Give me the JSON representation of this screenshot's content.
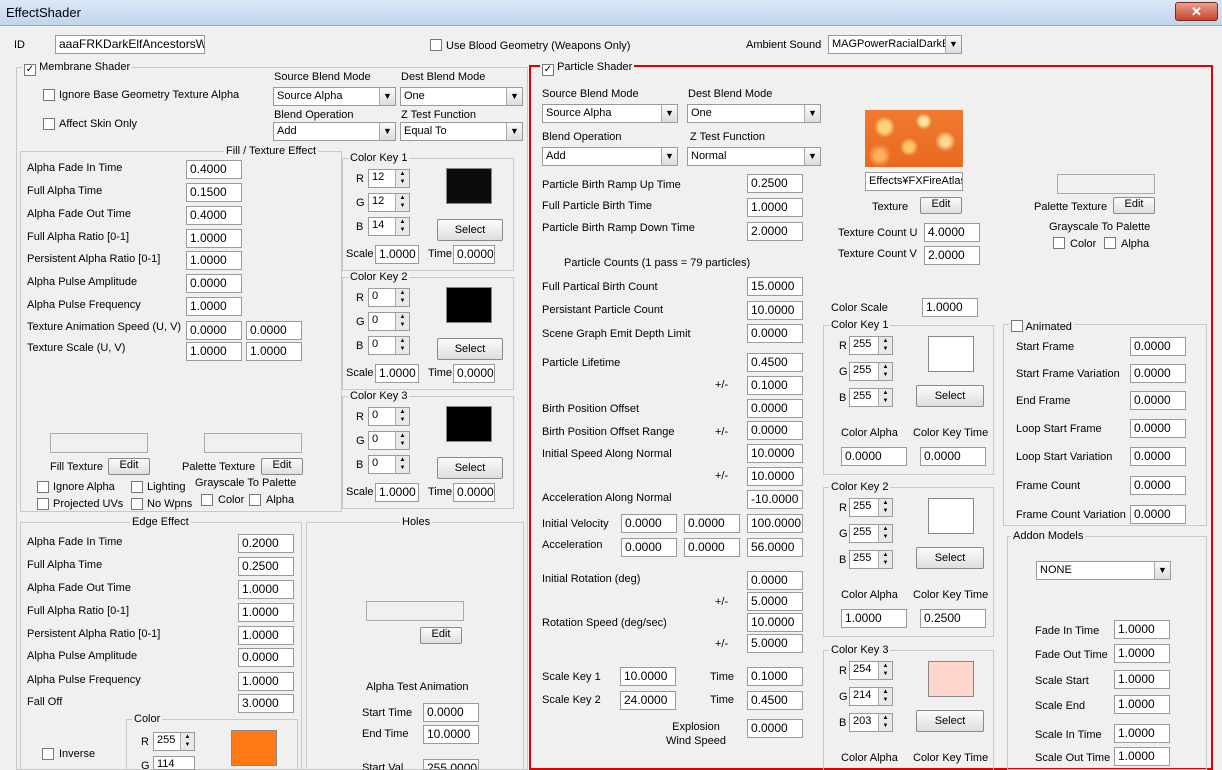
{
  "window": {
    "title": "EffectShader",
    "close": "✕"
  },
  "top": {
    "id_label": "ID",
    "id_value": "aaaFRKDarkElfAncestorsWrath",
    "blood_label": "Use Blood Geometry (Weapons Only)",
    "sound_label": "Ambient Sound",
    "sound_value": "MAGPowerRacialDarkElf"
  },
  "membrane": {
    "title": "Membrane Shader",
    "check": "✓",
    "ignore_base": "Ignore Base Geometry Texture Alpha",
    "affect_skin": "Affect Skin Only",
    "src_blend_label": "Source Blend Mode",
    "src_blend": "Source Alpha",
    "dst_blend_label": "Dest Blend Mode",
    "dst_blend": "One",
    "blend_op_label": "Blend Operation",
    "blend_op": "Add",
    "ztest_label": "Z Test Function",
    "ztest": "Equal To"
  },
  "fill": {
    "title": "Fill / Texture Effect",
    "rows": [
      [
        "Alpha Fade In Time",
        "0.4000"
      ],
      [
        "Full Alpha Time",
        "0.1500"
      ],
      [
        "Alpha Fade Out Time",
        "0.4000"
      ],
      [
        "Full Alpha Ratio [0-1]",
        "1.0000"
      ],
      [
        "Persistent Alpha Ratio [0-1]",
        "1.0000"
      ],
      [
        "Alpha Pulse Amplitude",
        "0.0000"
      ],
      [
        "Alpha Pulse Frequency",
        "1.0000"
      ]
    ],
    "anim_speed_label": "Texture Animation Speed (U, V)",
    "anim_u": "0.0000",
    "anim_v": "0.0000",
    "scale_label": "Texture Scale (U, V)",
    "scale_u": "1.0000",
    "scale_v": "1.0000",
    "fill_tex": "Fill Texture",
    "palette_tex": "Palette Texture",
    "edit": "Edit",
    "ignore_alpha": "Ignore Alpha",
    "lighting": "Lighting",
    "projected": "Projected UVs",
    "no_wpns": "No Wpns",
    "grayscale": "Grayscale To Palette",
    "color": "Color",
    "alpha": "Alpha"
  },
  "mkeys": [
    {
      "title": "Color Key 1",
      "r": "12",
      "g": "12",
      "b": "14",
      "scale": "1.0000",
      "time": "0.0000",
      "swatch": "#0c0c0e"
    },
    {
      "title": "Color Key 2",
      "r": "0",
      "g": "0",
      "b": "0",
      "scale": "1.0000",
      "time": "0.0000",
      "swatch": "#000000"
    },
    {
      "title": "Color Key 3",
      "r": "0",
      "g": "0",
      "b": "0",
      "scale": "1.0000",
      "time": "0.0000",
      "swatch": "#000000"
    }
  ],
  "labels": {
    "r": "R",
    "g": "G",
    "b": "B",
    "scale": "Scale",
    "time": "Time",
    "select": "Select",
    "pm": "+/-"
  },
  "edge": {
    "title": "Edge Effect",
    "rows": [
      [
        "Alpha Fade In Time",
        "0.2000"
      ],
      [
        "Full Alpha Time",
        "0.2500"
      ],
      [
        "Alpha Fade Out Time",
        "1.0000"
      ],
      [
        "Full Alpha Ratio [0-1]",
        "1.0000"
      ],
      [
        "Persistent Alpha Ratio [0-1]",
        "1.0000"
      ],
      [
        "Alpha Pulse Amplitude",
        "0.0000"
      ],
      [
        "Alpha Pulse Frequency",
        "1.0000"
      ],
      [
        "Fall Off",
        "3.0000"
      ]
    ],
    "color_title": "Color",
    "r": "255",
    "g": "114",
    "inverse": "Inverse",
    "swatch": "#ff7a14"
  },
  "holes": {
    "title": "Holes",
    "edit": "Edit",
    "anim_title": "Alpha Test Animation",
    "start_time": "Start Time",
    "start_time_v": "0.0000",
    "end_time": "End Time",
    "end_time_v": "10.0000",
    "start_val": "Start Val",
    "start_val_v": "255.0000"
  },
  "particle": {
    "title": "Particle Shader",
    "check": "✓",
    "src_blend_label": "Source Blend Mode",
    "src_blend": "Source Alpha",
    "dst_blend_label": "Dest Blend Mode",
    "dst_blend": "One",
    "blend_op_label": "Blend Operation",
    "blend_op": "Add",
    "ztest_label": "Z Test Function",
    "ztest": "Normal",
    "ramp_up": "Particle Birth Ramp Up Time",
    "ramp_up_v": "0.2500",
    "full_birth": "Full Particle Birth Time",
    "full_birth_v": "1.0000",
    "ramp_down": "Particle Birth Ramp Down Time",
    "ramp_down_v": "2.0000",
    "counts_note": "Particle Counts (1 pass = 79 particles)",
    "full_count": "Full Partical Birth Count",
    "full_count_v": "15.0000",
    "persist": "Persistant Particle Count",
    "persist_v": "10.0000",
    "depth": "Scene Graph Emit Depth Limit",
    "depth_v": "0.0000",
    "lifetime": "Particle Lifetime",
    "lifetime_v": "0.4500",
    "lifetime_pm": "0.1000",
    "birth_off": "Birth Position Offset",
    "birth_off_v": "0.0000",
    "birth_range": "Birth Position Offset Range",
    "birth_range_v": "0.0000",
    "init_speed": "Initial Speed Along Normal",
    "init_speed_v": "10.0000",
    "init_speed_pm": "10.0000",
    "accel_normal": "Acceleration Along Normal",
    "accel_normal_v": "-10.0000",
    "init_vel": "Initial Velocity",
    "vel_x": "0.0000",
    "vel_y": "0.0000",
    "vel_z": "100.0000",
    "accel": "Acceleration",
    "acc_x": "0.0000",
    "acc_y": "0.0000",
    "acc_z": "56.0000",
    "init_rot": "Initial Rotation (deg)",
    "init_rot_v": "0.0000",
    "init_rot_pm": "5.0000",
    "rot_speed": "Rotation Speed (deg/sec)",
    "rot_speed_v": "10.0000",
    "rot_speed_pm": "5.0000",
    "scale_key1": "Scale Key 1",
    "scale_key1_v": "10.0000",
    "time1_v": "0.1000",
    "scale_key2": "Scale Key 2",
    "scale_key2_v": "24.0000",
    "time2_v": "0.4500",
    "explosion": "Explosion Wind Speed",
    "explosion_v": "0.0000",
    "texture_path": "Effects¥FXFireAtlas",
    "texture": "Texture",
    "edit": "Edit",
    "tex_count_u": "Texture Count U",
    "tex_count_u_v": "4.0000",
    "tex_count_v": "Texture Count V",
    "tex_count_v_v": "2.0000",
    "palette": "Palette Texture",
    "grayscale": "Grayscale To Palette",
    "color": "Color",
    "alpha": "Alpha",
    "color_scale": "Color Scale",
    "color_scale_v": "1.0000",
    "color_alpha": "Color Alpha",
    "color_key_time": "Color Key Time"
  },
  "pkeys": [
    {
      "title": "Color Key 1",
      "r": "255",
      "g": "255",
      "b": "255",
      "alpha": "0.0000",
      "time": "0.0000",
      "swatch": "#ffffff"
    },
    {
      "title": "Color Key 2",
      "r": "255",
      "g": "255",
      "b": "255",
      "alpha": "1.0000",
      "time": "0.2500",
      "swatch": "#ffffff"
    },
    {
      "title": "Color Key 3",
      "r": "254",
      "g": "214",
      "b": "203",
      "swatch": "#fed6cb"
    }
  ],
  "animated": {
    "title": "Animated",
    "rows": [
      [
        "Start Frame",
        "0.0000"
      ],
      [
        "Start Frame Variation",
        "0.0000"
      ],
      [
        "End Frame",
        "0.0000"
      ],
      [
        "Loop Start Frame",
        "0.0000"
      ],
      [
        "Loop Start Variation",
        "0.0000"
      ],
      [
        "Frame Count",
        "0.0000"
      ],
      [
        "Frame Count Variation",
        "0.0000"
      ]
    ]
  },
  "addon": {
    "title": "Addon Models",
    "model": "NONE",
    "rows": [
      [
        "Fade In Time",
        "1.0000"
      ],
      [
        "Fade Out Time",
        "1.0000"
      ],
      [
        "Scale Start",
        "1.0000"
      ],
      [
        "Scale End",
        "1.0000"
      ],
      [
        "Scale In Time",
        "1.0000"
      ],
      [
        "Scale Out Time",
        "1.0000"
      ]
    ]
  }
}
